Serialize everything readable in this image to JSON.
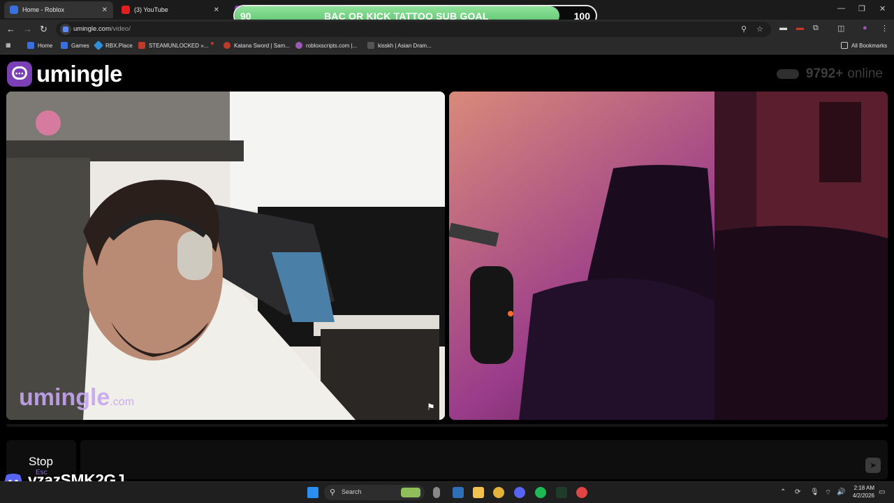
{
  "browser": {
    "tabs": [
      {
        "title": "Home - Roblox",
        "active": true
      },
      {
        "title": "(3) YouTube",
        "active": false
      }
    ],
    "url_host": "umingle.com",
    "url_path": "/video/",
    "bookmarks": [
      "Home",
      "Games",
      "RBX.Place",
      "STEAMUNLOCKED »...",
      "Katana Sword | Sam...",
      "robloxscripts.com |...",
      "kisskh | Asian Dram..."
    ],
    "all_bookmarks": "All Bookmarks"
  },
  "overlay": {
    "goal_title": "BAC OR KICK TATTOO SUB GOAL",
    "goal_current": "90",
    "goal_target": "100",
    "goal_progress": 0.9
  },
  "page": {
    "logo_text": "umingle",
    "online_count": "9792",
    "online_plus": "+",
    "online_label": "online",
    "watermark": "umingle",
    "watermark_suffix": ".com",
    "stop_label": "Stop",
    "stop_shortcut": "Esc"
  },
  "stream_tag": {
    "handle": "vzazSMK2GJ"
  },
  "taskbar": {
    "search_placeholder": "Search",
    "time": "2:18 AM",
    "date": "4/2/2026"
  },
  "colors": {
    "brand_purple": "#7b3fb6",
    "goal_green": "#6fd37f",
    "discord_blurple": "#5865f2"
  }
}
